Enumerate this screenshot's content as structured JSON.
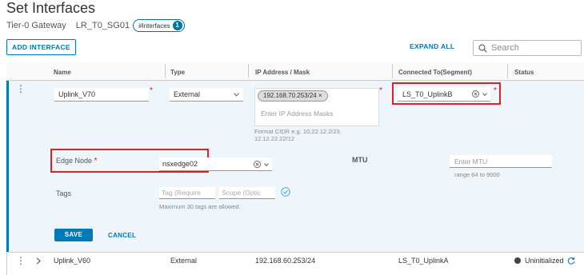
{
  "page": {
    "title": "Set Interfaces",
    "gateway_type": "Tier-0 Gateway",
    "gateway_name": "LR_T0_SG01",
    "interfaces_pill": "#Interfaces",
    "interfaces_count": "1"
  },
  "toolbar": {
    "add_label": "ADD INTERFACE",
    "expand_label": "EXPAND ALL",
    "search_placeholder": "Search"
  },
  "table": {
    "columns": [
      "Name",
      "Type",
      "IP Address / Mask",
      "Connected To(Segment)",
      "Status"
    ]
  },
  "expanded_row": {
    "name": "Uplink_V70",
    "type": "External",
    "ip_chip": "192.168.70.253/24 ×",
    "ip_placeholder": "Enter IP Address Masks",
    "ip_hint": "Format CIDR e.g. 10.22.12.2/23, 12.12.22.22/12",
    "segment": "LS_T0_UplinkB",
    "edge_node_label": "Edge Node",
    "required_mark": "*",
    "edge_node_value": "nsxedge02",
    "mtu_label": "MTU",
    "mtu_placeholder": "Enter MTU",
    "mtu_hint": "range 64 to 9000",
    "tags_label": "Tags",
    "tag_placeholder": "Tag (Require",
    "scope_placeholder": "Scope (Optic",
    "tags_hint": "Maximum 30 tags are allowed.",
    "save_label": "SAVE",
    "cancel_label": "CANCEL"
  },
  "collapsed_row": {
    "name": "Uplink_V60",
    "type": "External",
    "ip": "192.168.60.253/24",
    "segment": "LS_T0_UplinkA",
    "status": "Uninitialized"
  },
  "colors": {
    "accent": "#0079b8",
    "highlight": "#e02020",
    "expanded_bg": "#eef6fb"
  }
}
